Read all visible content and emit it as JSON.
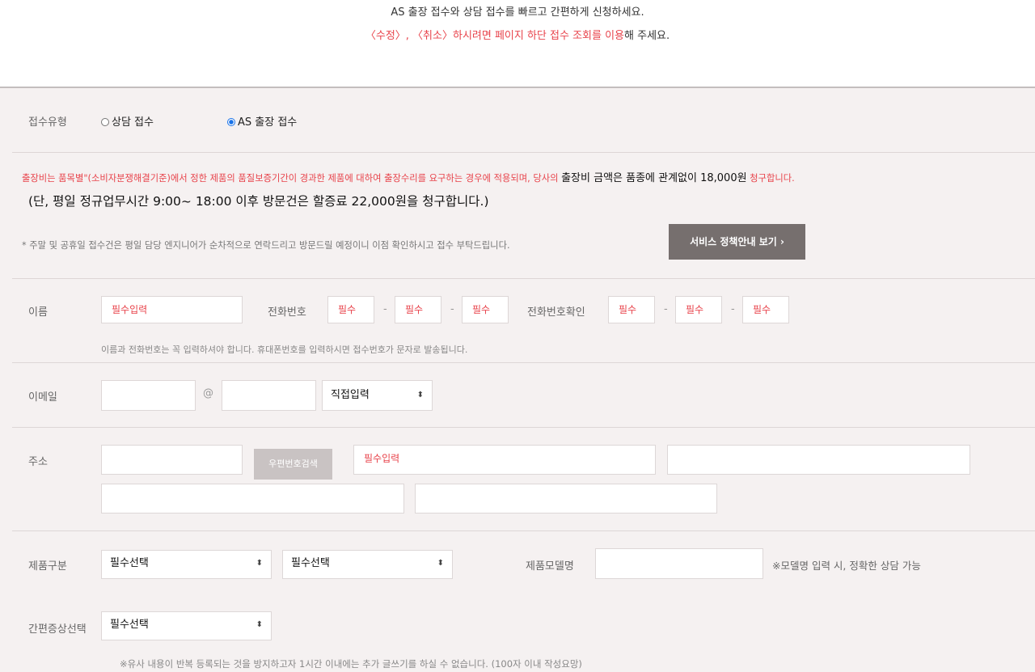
{
  "intro": {
    "line1": "AS 출장 접수와 상담 접수를 빠르고 간편하게 신청하세요.",
    "line2_red": "〈수정〉, 〈취소〉하시려면 페이지 하단 접수 조회를 이용",
    "line2_rest": "해 주세요."
  },
  "reception": {
    "label": "접수유형",
    "options": [
      "상담 접수",
      "AS 출장 접수"
    ],
    "selected": "AS 출장 접수"
  },
  "fee_notice": {
    "part1_red": "출장비는 품목별\"(소비자분쟁해결기준)에서 정한 제품의 품질보증기간이 경과한 제품에 대하여 출장수리를 요구하는 경우에 적용되며, 당사의 ",
    "part2_black": "출장비 금액은 품종에 관계없이 18,000원",
    "part3_red": " 청구합니다.",
    "line2": "(단, 평일 정규업무시간 9:00~ 18:00 이후 방문건은 할증료 22,000원을 청구합니다.)",
    "weekend_note": "* 주말 및 공휴일 접수건은 평일 담당 엔지니어가 순차적으로 연락드리고 방문드릴 예정이니 이점 확인하시고 접수 부탁드립니다.",
    "policy_button": "서비스 정책안내 보기  ›"
  },
  "name_row": {
    "name_label": "이름",
    "name_placeholder": "필수입력",
    "phone_label": "전화번호",
    "phone_placeholders": [
      "필수",
      "필수",
      "필수"
    ],
    "phone_confirm_label": "전화번호확인",
    "phone_confirm_placeholders": [
      "필수",
      "필수",
      "필수"
    ],
    "dash": "-",
    "note": "이름과 전화번호는 꼭 입력하셔야 합니다. 휴대폰번호를 입력하시면 접수번호가 문자로 발송됩니다."
  },
  "email_row": {
    "label": "이메일",
    "at": "@",
    "domain_select": "직접입력"
  },
  "address_row": {
    "label": "주소",
    "search_button": "우편번호검색",
    "required_placeholder": "필수입력"
  },
  "product_row": {
    "label": "제품구분",
    "select1": "필수선택",
    "select2": "필수선택",
    "model_label": "제품모델명",
    "model_note": "※모델명 입력 시, 정확한 상담 가능"
  },
  "symptom_row": {
    "label": "간편증상선택",
    "select": "필수선택",
    "note": "※유사 내용이 반복 등록되는 것을 방지하고자 1시간 이내에는 추가 글쓰기를 하실 수 없습니다. (100자 이내 작성요망)"
  },
  "colors": {
    "accent_red": "#e8434b",
    "panel_bg": "#f5f1f1",
    "button_dark": "#766f6e",
    "button_grey": "#c9c3c3"
  }
}
